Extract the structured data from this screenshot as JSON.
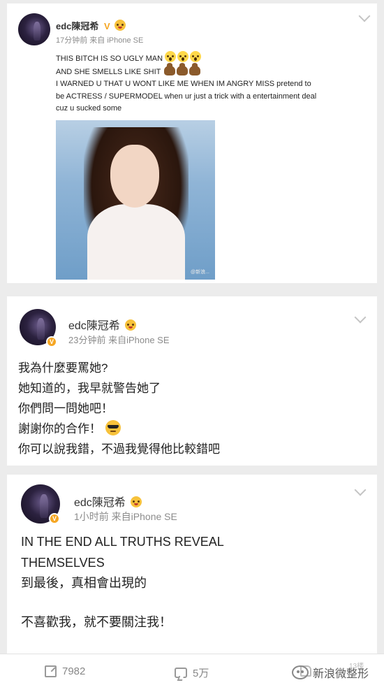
{
  "posts": [
    {
      "username": "edc陳冠希",
      "verified_mark": "V",
      "meta": "17分钟前 来自 iPhone SE",
      "lines": [
        "THIS BITCH IS SO UGLY MAN",
        "AND SHE SMELLS LIKE SHIT",
        "I WARNED U THAT U WONT LIKE ME WHEN IM ANGRY MISS pretend to",
        "be ACTRESS / SUPERMODEL when ur just a trick with a entertainment deal",
        "cuz u sucked some"
      ],
      "image_watermark": "@新浪..."
    },
    {
      "username": "edc陳冠希",
      "meta": "23分钟前  来自iPhone SE",
      "lines": [
        "我為什麼要罵她?",
        "她知道的，我早就警告她了",
        "你們問一問她吧！",
        "謝謝你的合作！",
        "你可以說我錯，不過我覺得他比較錯吧"
      ]
    },
    {
      "username": "edc陳冠希",
      "meta": "1小时前  来自iPhone SE",
      "lines": [
        "IN THE END ALL TRUTHS REVEAL",
        "THEMSELVES",
        "到最後，真相會出現的",
        "不喜歡我，就不要關注我！"
      ]
    }
  ],
  "footer": {
    "reposts": "7982",
    "comments": "5万",
    "likes": "13楼",
    "watermark": "新浪微整形"
  },
  "icons": [
    "chevron-down-icon",
    "verified-badge-icon",
    "repost-icon",
    "comment-icon",
    "like-icon",
    "weibo-logo-icon"
  ],
  "colors": {
    "accent": "#f5a623",
    "meta": "#8c8c8c",
    "background": "#ececec"
  }
}
